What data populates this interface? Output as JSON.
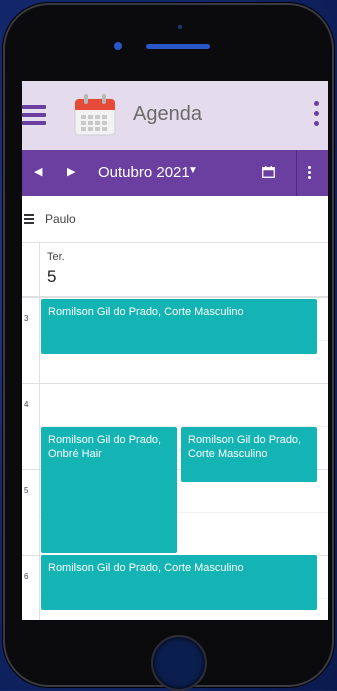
{
  "app": {
    "title": "Agenda"
  },
  "toolbar": {
    "prev": "◀",
    "next": "▶",
    "month": "Outubro 2021",
    "caret": "▼"
  },
  "resource": {
    "name": "Paulo"
  },
  "day": {
    "weekday": "Ter.",
    "number": "5"
  },
  "hours": [
    "3",
    "4",
    "5",
    "6"
  ],
  "events": [
    {
      "text": "Romilson Gil do Prado, Corte Masculino"
    },
    {
      "text": "Romilson Gil do Prado, Onbré Hair"
    },
    {
      "text": "Romilson Gil do Prado, Corte Masculino"
    },
    {
      "text": "Romilson Gil do Prado, Corte Masculino"
    }
  ],
  "colors": {
    "appbar": "#e4dcec",
    "toolbar": "#6a3fa0",
    "event": "#14b4b4",
    "accent": "#6b3fa0"
  }
}
